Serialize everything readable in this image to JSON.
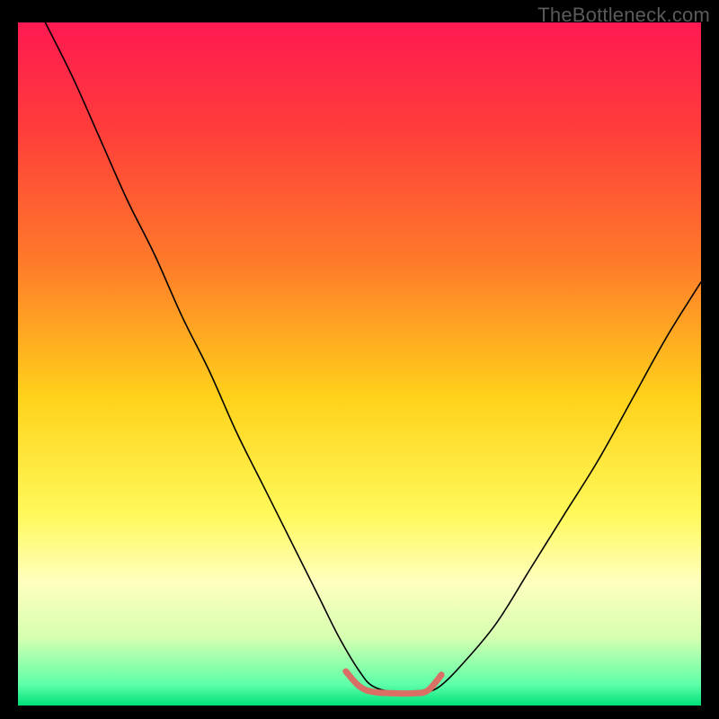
{
  "watermark": "TheBottleneck.com",
  "chart_data": {
    "type": "line",
    "title": "",
    "xlabel": "",
    "ylabel": "",
    "xlim": [
      0,
      100
    ],
    "ylim": [
      0,
      100
    ],
    "grid": false,
    "legend": false,
    "background_gradient": {
      "stops": [
        {
          "offset": 0.0,
          "color": "#ff1a52"
        },
        {
          "offset": 0.15,
          "color": "#ff3b3b"
        },
        {
          "offset": 0.35,
          "color": "#ff7a2a"
        },
        {
          "offset": 0.55,
          "color": "#ffd21a"
        },
        {
          "offset": 0.72,
          "color": "#fff95a"
        },
        {
          "offset": 0.82,
          "color": "#ffffbf"
        },
        {
          "offset": 0.9,
          "color": "#d6ffb0"
        },
        {
          "offset": 0.97,
          "color": "#5cffa8"
        },
        {
          "offset": 1.0,
          "color": "#00e07a"
        }
      ]
    },
    "series": [
      {
        "name": "bottleneck-curve",
        "stroke": "#000000",
        "stroke_width": 1.6,
        "x": [
          4,
          8,
          12,
          16,
          20,
          24,
          28,
          32,
          36,
          40,
          44,
          47,
          50,
          52,
          55,
          58,
          60,
          62,
          65,
          70,
          75,
          80,
          85,
          90,
          95,
          100
        ],
        "y": [
          100,
          92,
          83,
          74,
          66,
          57,
          49,
          40,
          32,
          24,
          16,
          10,
          5,
          2.8,
          2.0,
          1.8,
          2.0,
          3.0,
          6,
          12,
          20,
          28,
          36,
          45,
          54,
          62
        ]
      },
      {
        "name": "optimal-range-marker",
        "stroke": "#da6f66",
        "stroke_width": 7,
        "linecap": "round",
        "x": [
          48,
          50,
          52,
          55,
          58,
          60,
          62
        ],
        "y": [
          5.0,
          2.8,
          2.0,
          1.8,
          1.8,
          2.2,
          4.5
        ]
      }
    ]
  }
}
